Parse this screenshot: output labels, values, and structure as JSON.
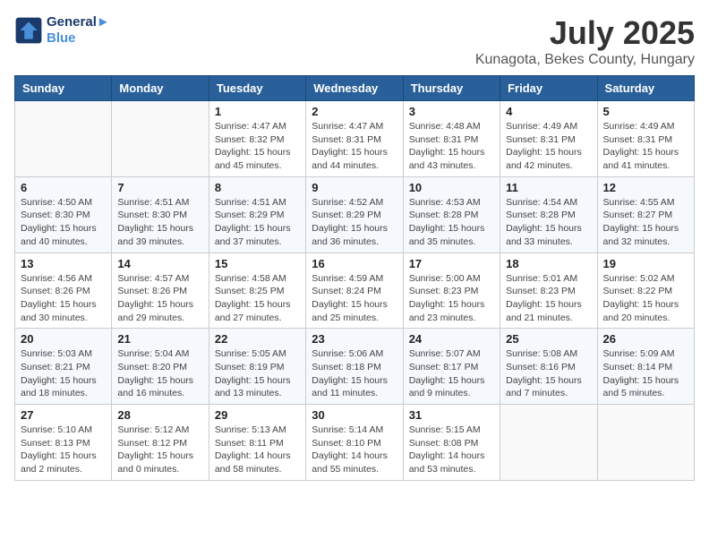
{
  "header": {
    "logo_line1": "General",
    "logo_line2": "Blue",
    "title": "July 2025",
    "subtitle": "Kunagota, Bekes County, Hungary"
  },
  "days_of_week": [
    "Sunday",
    "Monday",
    "Tuesday",
    "Wednesday",
    "Thursday",
    "Friday",
    "Saturday"
  ],
  "weeks": [
    [
      {
        "day": "",
        "info": ""
      },
      {
        "day": "",
        "info": ""
      },
      {
        "day": "1",
        "info": "Sunrise: 4:47 AM\nSunset: 8:32 PM\nDaylight: 15 hours and 45 minutes."
      },
      {
        "day": "2",
        "info": "Sunrise: 4:47 AM\nSunset: 8:31 PM\nDaylight: 15 hours and 44 minutes."
      },
      {
        "day": "3",
        "info": "Sunrise: 4:48 AM\nSunset: 8:31 PM\nDaylight: 15 hours and 43 minutes."
      },
      {
        "day": "4",
        "info": "Sunrise: 4:49 AM\nSunset: 8:31 PM\nDaylight: 15 hours and 42 minutes."
      },
      {
        "day": "5",
        "info": "Sunrise: 4:49 AM\nSunset: 8:31 PM\nDaylight: 15 hours and 41 minutes."
      }
    ],
    [
      {
        "day": "6",
        "info": "Sunrise: 4:50 AM\nSunset: 8:30 PM\nDaylight: 15 hours and 40 minutes."
      },
      {
        "day": "7",
        "info": "Sunrise: 4:51 AM\nSunset: 8:30 PM\nDaylight: 15 hours and 39 minutes."
      },
      {
        "day": "8",
        "info": "Sunrise: 4:51 AM\nSunset: 8:29 PM\nDaylight: 15 hours and 37 minutes."
      },
      {
        "day": "9",
        "info": "Sunrise: 4:52 AM\nSunset: 8:29 PM\nDaylight: 15 hours and 36 minutes."
      },
      {
        "day": "10",
        "info": "Sunrise: 4:53 AM\nSunset: 8:28 PM\nDaylight: 15 hours and 35 minutes."
      },
      {
        "day": "11",
        "info": "Sunrise: 4:54 AM\nSunset: 8:28 PM\nDaylight: 15 hours and 33 minutes."
      },
      {
        "day": "12",
        "info": "Sunrise: 4:55 AM\nSunset: 8:27 PM\nDaylight: 15 hours and 32 minutes."
      }
    ],
    [
      {
        "day": "13",
        "info": "Sunrise: 4:56 AM\nSunset: 8:26 PM\nDaylight: 15 hours and 30 minutes."
      },
      {
        "day": "14",
        "info": "Sunrise: 4:57 AM\nSunset: 8:26 PM\nDaylight: 15 hours and 29 minutes."
      },
      {
        "day": "15",
        "info": "Sunrise: 4:58 AM\nSunset: 8:25 PM\nDaylight: 15 hours and 27 minutes."
      },
      {
        "day": "16",
        "info": "Sunrise: 4:59 AM\nSunset: 8:24 PM\nDaylight: 15 hours and 25 minutes."
      },
      {
        "day": "17",
        "info": "Sunrise: 5:00 AM\nSunset: 8:23 PM\nDaylight: 15 hours and 23 minutes."
      },
      {
        "day": "18",
        "info": "Sunrise: 5:01 AM\nSunset: 8:23 PM\nDaylight: 15 hours and 21 minutes."
      },
      {
        "day": "19",
        "info": "Sunrise: 5:02 AM\nSunset: 8:22 PM\nDaylight: 15 hours and 20 minutes."
      }
    ],
    [
      {
        "day": "20",
        "info": "Sunrise: 5:03 AM\nSunset: 8:21 PM\nDaylight: 15 hours and 18 minutes."
      },
      {
        "day": "21",
        "info": "Sunrise: 5:04 AM\nSunset: 8:20 PM\nDaylight: 15 hours and 16 minutes."
      },
      {
        "day": "22",
        "info": "Sunrise: 5:05 AM\nSunset: 8:19 PM\nDaylight: 15 hours and 13 minutes."
      },
      {
        "day": "23",
        "info": "Sunrise: 5:06 AM\nSunset: 8:18 PM\nDaylight: 15 hours and 11 minutes."
      },
      {
        "day": "24",
        "info": "Sunrise: 5:07 AM\nSunset: 8:17 PM\nDaylight: 15 hours and 9 minutes."
      },
      {
        "day": "25",
        "info": "Sunrise: 5:08 AM\nSunset: 8:16 PM\nDaylight: 15 hours and 7 minutes."
      },
      {
        "day": "26",
        "info": "Sunrise: 5:09 AM\nSunset: 8:14 PM\nDaylight: 15 hours and 5 minutes."
      }
    ],
    [
      {
        "day": "27",
        "info": "Sunrise: 5:10 AM\nSunset: 8:13 PM\nDaylight: 15 hours and 2 minutes."
      },
      {
        "day": "28",
        "info": "Sunrise: 5:12 AM\nSunset: 8:12 PM\nDaylight: 15 hours and 0 minutes."
      },
      {
        "day": "29",
        "info": "Sunrise: 5:13 AM\nSunset: 8:11 PM\nDaylight: 14 hours and 58 minutes."
      },
      {
        "day": "30",
        "info": "Sunrise: 5:14 AM\nSunset: 8:10 PM\nDaylight: 14 hours and 55 minutes."
      },
      {
        "day": "31",
        "info": "Sunrise: 5:15 AM\nSunset: 8:08 PM\nDaylight: 14 hours and 53 minutes."
      },
      {
        "day": "",
        "info": ""
      },
      {
        "day": "",
        "info": ""
      }
    ]
  ]
}
